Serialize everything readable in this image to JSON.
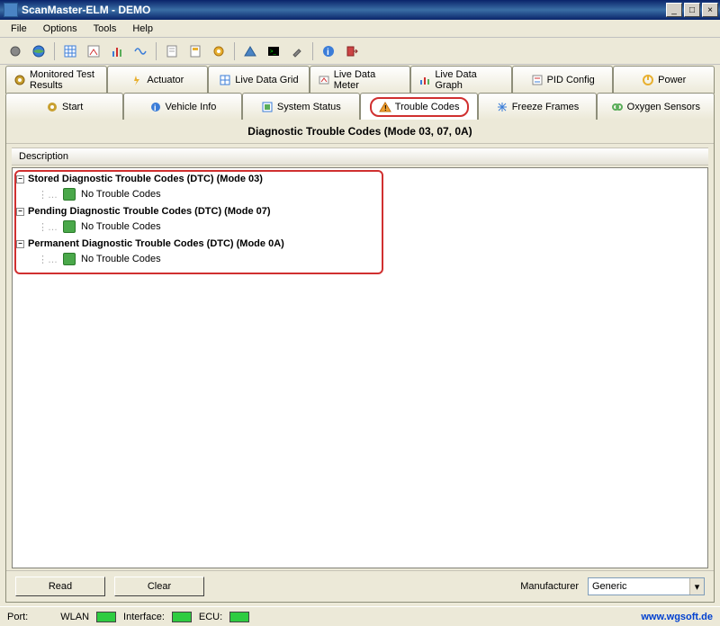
{
  "window": {
    "title": "ScanMaster-ELM - DEMO"
  },
  "menu": {
    "file": "File",
    "options": "Options",
    "tools": "Tools",
    "help": "Help"
  },
  "tabs_row1": {
    "monitored": "Monitored Test Results",
    "actuator": "Actuator",
    "grid": "Live Data Grid",
    "meter": "Live Data Meter",
    "graph": "Live Data Graph",
    "pid": "PID Config",
    "power": "Power"
  },
  "tabs_row2": {
    "start": "Start",
    "vehicle": "Vehicle Info",
    "system": "System Status",
    "trouble": "Trouble Codes",
    "freeze": "Freeze Frames",
    "oxygen": "Oxygen Sensors"
  },
  "panel": {
    "title": "Diagnostic Trouble Codes (Mode 03, 07, 0A)",
    "column": "Description"
  },
  "tree": {
    "stored": {
      "label": "Stored Diagnostic Trouble Codes (DTC) (Mode 03)",
      "child": "No Trouble Codes"
    },
    "pending": {
      "label": "Pending Diagnostic Trouble Codes (DTC) (Mode 07)",
      "child": "No Trouble Codes"
    },
    "permanent": {
      "label": "Permanent Diagnostic Trouble Codes (DTC) (Mode 0A)",
      "child": "No Trouble Codes"
    }
  },
  "buttons": {
    "read": "Read",
    "clear": "Clear",
    "manufacturer_label": "Manufacturer",
    "manufacturer_value": "Generic"
  },
  "status": {
    "port": "Port:",
    "wlan": "WLAN",
    "interface": "Interface:",
    "ecu": "ECU:",
    "url": "www.wgsoft.de"
  },
  "colors": {
    "accent_red": "#d03030",
    "status_green": "#2ecc40"
  }
}
